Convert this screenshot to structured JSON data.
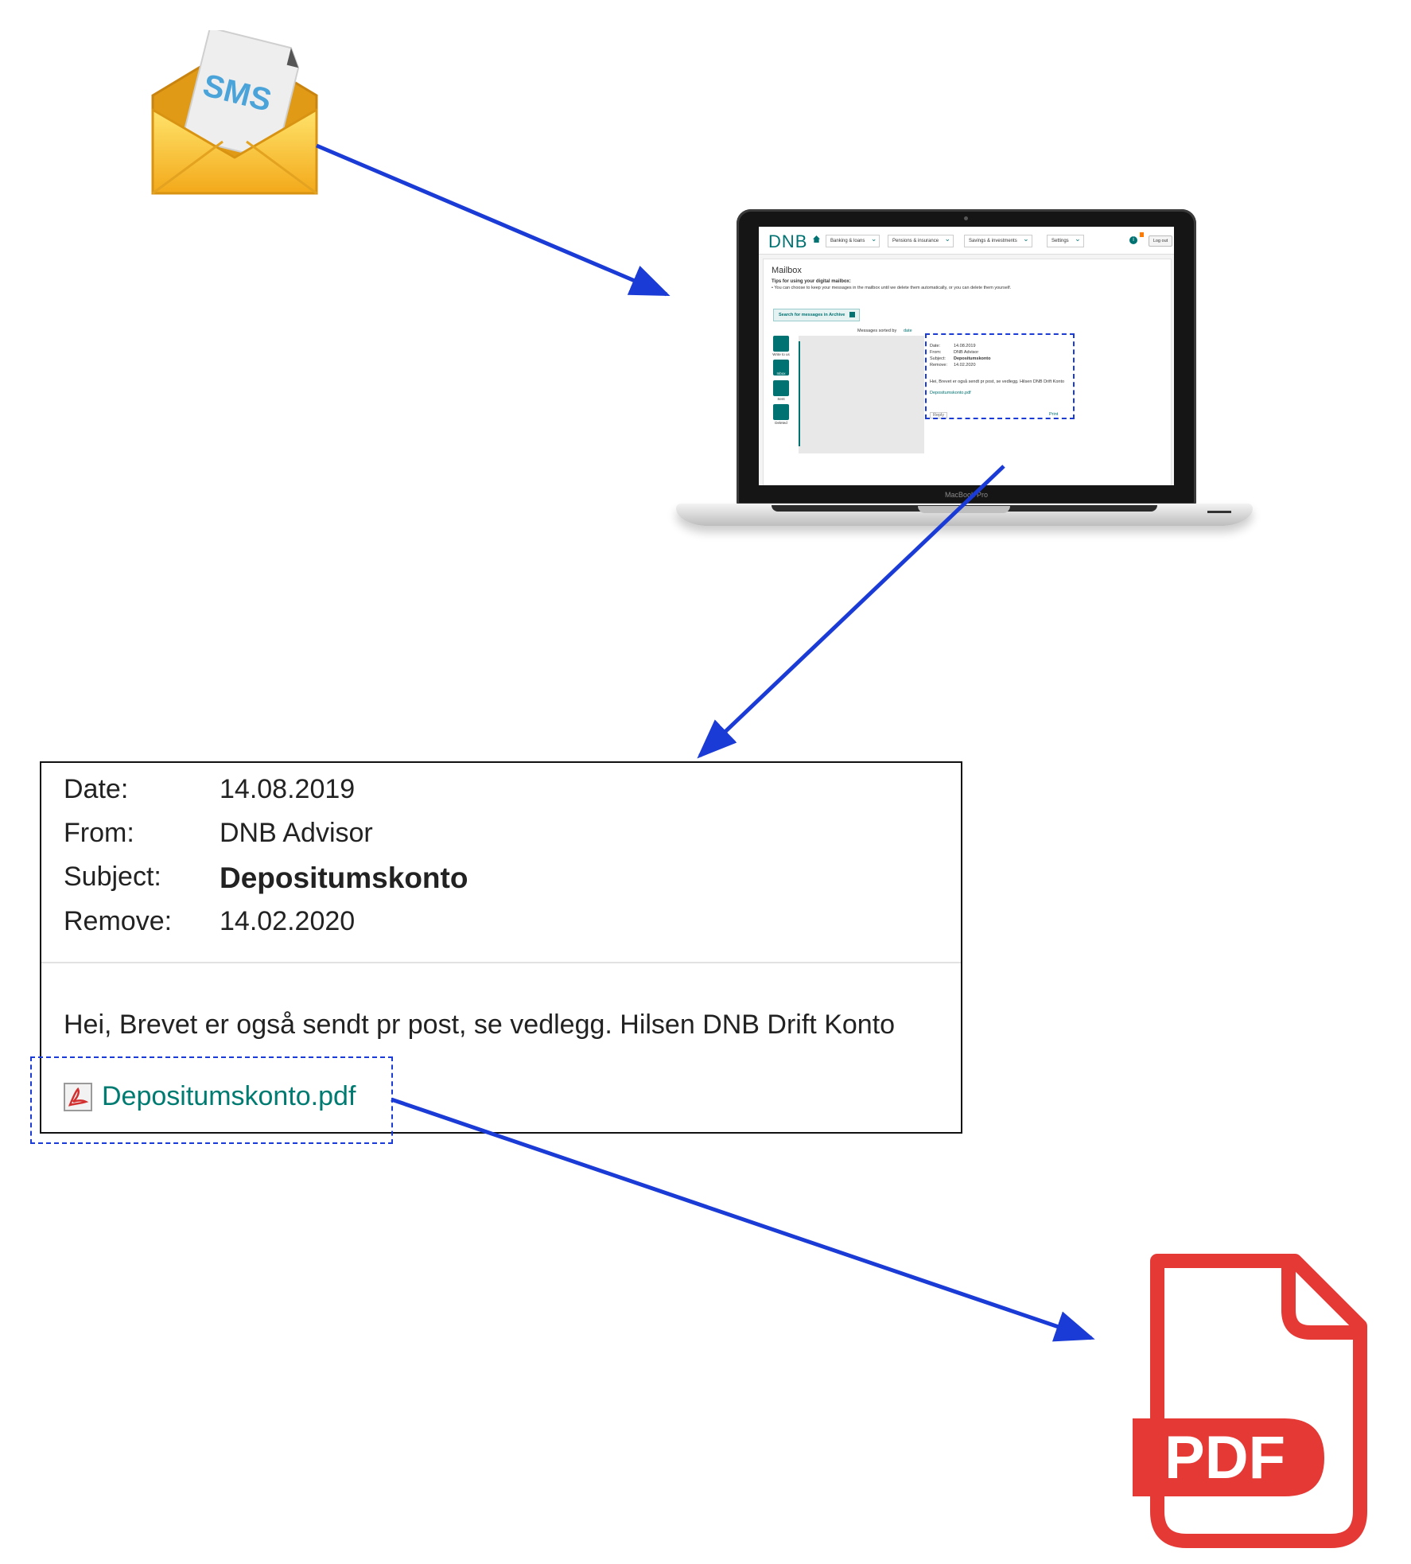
{
  "sms_icon": {
    "label": "SMS"
  },
  "laptop": {
    "brand": "MacBook Pro",
    "screen": {
      "logo": "DNB",
      "nav_items": [
        "Banking & loans",
        "Pensions & insurance",
        "Savings & investments",
        "Settings"
      ],
      "logout": "Log out",
      "page_title": "Mailbox",
      "tips_heading": "Tips for using your digital mailbox:",
      "tips_body": "• You can choose to keep your messages in the mailbox until we delete them automatically, or you can delete them yourself.",
      "search_archive": "Search for messages in Archive",
      "sorted_by_label": "Messages sorted by",
      "sorted_by_value": "date",
      "side_buttons": [
        "Write to us",
        "Inbox",
        "Sent",
        "Deleted"
      ],
      "reply": "Reply",
      "print": "Print"
    }
  },
  "message": {
    "fields": [
      {
        "label": "Date:",
        "value": "14.08.2019"
      },
      {
        "label": "From:",
        "value": "DNB Advisor"
      },
      {
        "label": "Subject:",
        "value": "Depositumskonto"
      },
      {
        "label": "Remove:",
        "value": "14.02.2020"
      }
    ],
    "body": "Hei, Brevet er også sendt pr post, se vedlegg. Hilsen DNB Drift Konto",
    "attachment": "Depositumskonto.pdf"
  },
  "pdf_icon": {
    "label": "PDF"
  },
  "colors": {
    "arrow": "#1b3bd6",
    "dnb_teal": "#007272",
    "pdf_red": "#e53935",
    "envelope": "#f9c21a"
  }
}
